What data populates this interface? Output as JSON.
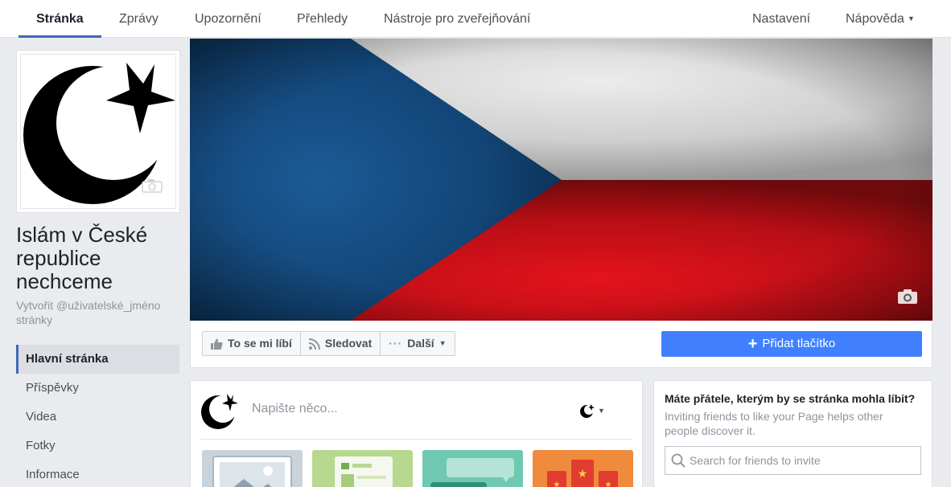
{
  "nav": {
    "tabs": [
      {
        "label": "Stránka"
      },
      {
        "label": "Zprávy"
      },
      {
        "label": "Upozornění"
      },
      {
        "label": "Přehledy"
      },
      {
        "label": "Nástroje pro zveřejňování"
      }
    ],
    "right": [
      {
        "label": "Nastavení"
      },
      {
        "label": "Nápověda"
      }
    ],
    "accent": "#4267b2"
  },
  "page": {
    "name": "Islám v České republice nechceme",
    "username_link": "Vytvořit @uživatelské_jméno stránky",
    "profile_icon": "crescent-star-icon"
  },
  "sidebar": {
    "items": [
      {
        "label": "Hlavní stránka"
      },
      {
        "label": "Příspěvky"
      },
      {
        "label": "Videa"
      },
      {
        "label": "Fotky"
      },
      {
        "label": "Informace"
      }
    ]
  },
  "cover": {
    "image": "czech-flag",
    "colors": {
      "blue": "#11457e",
      "white": "#ffffff",
      "red": "#d7141a"
    }
  },
  "actions": {
    "like": "To se mi líbí",
    "follow": "Sledovat",
    "more": "Další",
    "add_button": "Přidat tlačítko",
    "add_button_color": "#4080ff"
  },
  "composer": {
    "placeholder": "Napište něco..."
  },
  "invite": {
    "title": "Máte přátele, kterým by se stránka mohla líbit?",
    "description": "Inviting friends to like your Page helps other people discover it.",
    "search_placeholder": "Search for friends to invite"
  }
}
